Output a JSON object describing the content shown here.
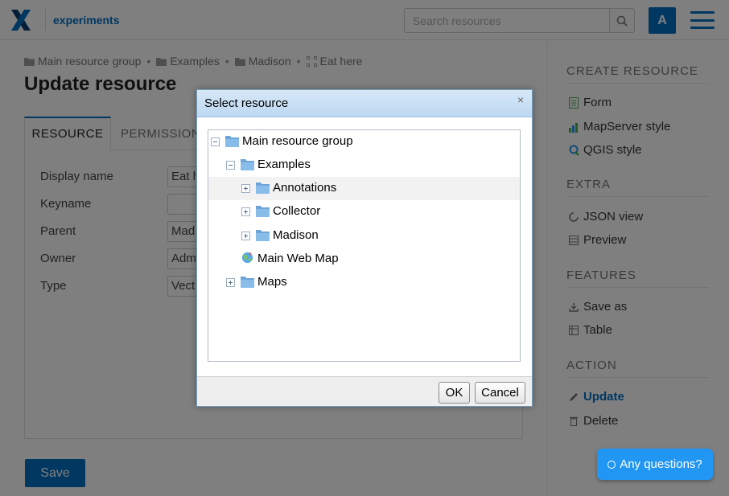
{
  "header": {
    "app_name": "experiments",
    "search_placeholder": "Search resources",
    "avatar_letter": "A",
    "accent": "#0070c5"
  },
  "breadcrumb": {
    "items": [
      "Main resource group",
      "Examples",
      "Madison",
      "Eat here"
    ],
    "separator": "•"
  },
  "page": {
    "title": "Update resource",
    "tabs": [
      "RESOURCE",
      "PERMISSIONS"
    ],
    "fields": [
      {
        "label": "Display name",
        "value": "Eat h"
      },
      {
        "label": "Keyname",
        "value": ""
      },
      {
        "label": "Parent",
        "value": "Mad"
      },
      {
        "label": "Owner",
        "value": "Adm"
      },
      {
        "label": "Type",
        "value": "Vect"
      }
    ],
    "save_label": "Save"
  },
  "sidebar": {
    "create_heading": "CREATE RESOURCE",
    "create_items": [
      "Form",
      "MapServer style",
      "QGIS style"
    ],
    "extra_heading": "EXTRA",
    "extra_items": [
      "JSON view",
      "Preview"
    ],
    "features_heading": "FEATURES",
    "features_items": [
      "Save as",
      "Table"
    ],
    "action_heading": "ACTION",
    "action_items": [
      "Update",
      "Delete"
    ]
  },
  "dialog": {
    "title": "Select resource",
    "close_glyph": "×",
    "tree": [
      {
        "label": "Main resource group",
        "icon": "folder-icon",
        "expander": "minus"
      },
      {
        "label": "Examples",
        "icon": "folder-icon",
        "expander": "minus"
      },
      {
        "label": "Annotations",
        "icon": "folder-icon",
        "expander": "plus",
        "highlighted": true
      },
      {
        "label": "Collector",
        "icon": "folder-icon",
        "expander": "plus"
      },
      {
        "label": "Madison",
        "icon": "folder-icon",
        "expander": "plus"
      },
      {
        "label": "Main Web Map",
        "icon": "web-map-icon",
        "expander": "none"
      },
      {
        "label": "Maps",
        "icon": "folder-icon",
        "expander": "plus"
      }
    ],
    "ok_label": "OK",
    "cancel_label": "Cancel"
  },
  "chat": {
    "label": "Any questions?"
  }
}
